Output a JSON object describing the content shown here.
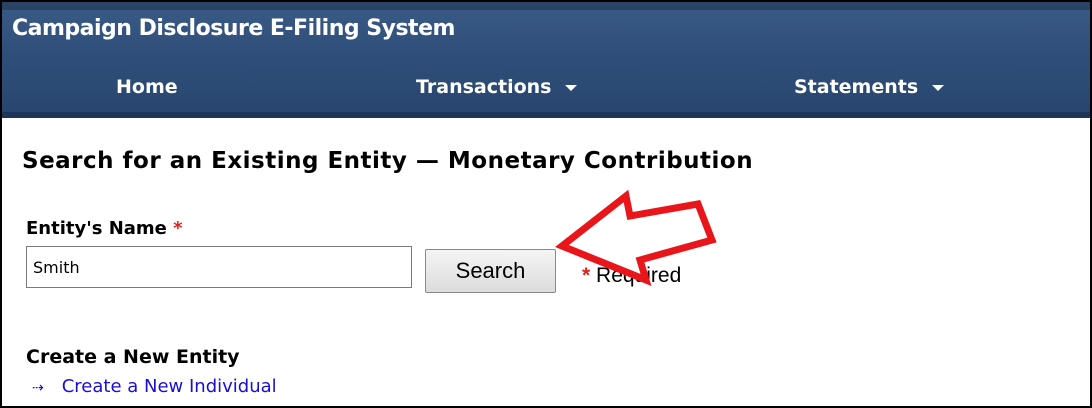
{
  "header": {
    "app_title": "Campaign Disclosure E-Filing System",
    "nav": [
      {
        "label": "Home"
      },
      {
        "label": "Transactions"
      },
      {
        "label": "Statements"
      }
    ],
    "colors": {
      "bar": "#2f4f7a",
      "text": "#ffffff"
    }
  },
  "main": {
    "title": "Search for an Existing Entity — Monetary Contribution",
    "entity_name": {
      "label": "Entity's Name",
      "required_mark": "*",
      "value": "Smith"
    },
    "search_button": "Search",
    "required_note": {
      "mark": "*",
      "text": "Required"
    },
    "create_section": {
      "heading": "Create a New Entity",
      "link_icon": "double-arrow-icon",
      "link_label": "Create a New Individual"
    }
  },
  "annotation": {
    "type": "arrow-callout",
    "color": "#e8161b",
    "points_to": "search-button"
  }
}
